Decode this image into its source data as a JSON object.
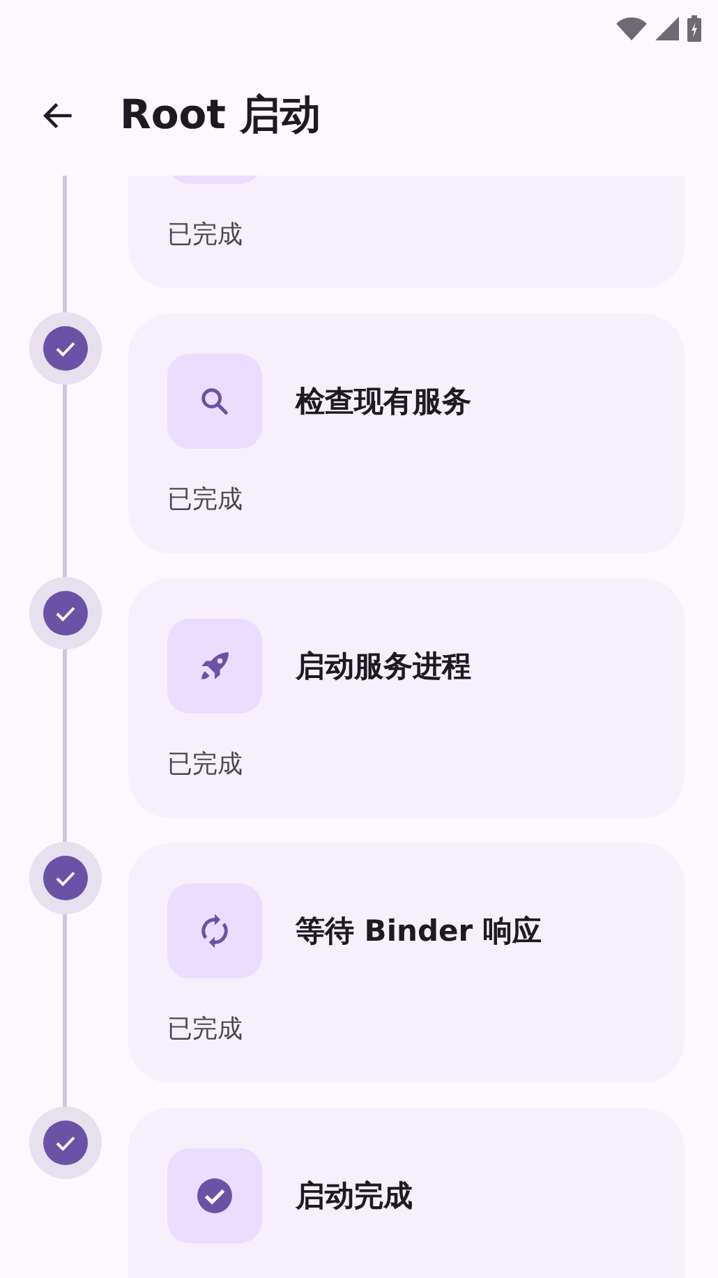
{
  "app_bar": {
    "title": "Root 启动"
  },
  "steps": [
    {
      "status": "已完成"
    },
    {
      "kind": "search",
      "title": "检查现有服务",
      "status": "已完成",
      "done": true
    },
    {
      "kind": "rocket",
      "title": "启动服务进程",
      "status": "已完成",
      "done": true
    },
    {
      "kind": "sync",
      "title": "等待 Binder 响应",
      "status": "已完成",
      "done": true
    },
    {
      "kind": "check",
      "title": "启动完成",
      "done": true
    }
  ]
}
